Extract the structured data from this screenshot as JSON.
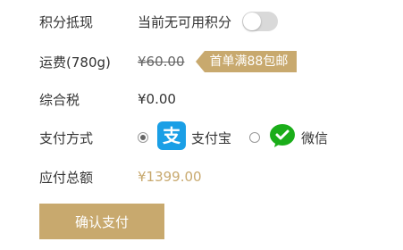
{
  "colors": {
    "accent": "#c8a96e",
    "toggle_off": "#d9d9d9",
    "alipay": "#1a9fe6",
    "wechat": "#1aad19"
  },
  "points": {
    "label": "积分抵现",
    "status": "当前无可用积分",
    "toggle_on": false
  },
  "shipping": {
    "label": "运费(780g)",
    "original_price": "¥60.00",
    "promo": "首单满88包邮"
  },
  "tax": {
    "label": "综合税",
    "value": "¥0.00"
  },
  "payment": {
    "label": "支付方式",
    "options": [
      {
        "name": "支付宝",
        "icon": "alipay-icon",
        "selected": true
      },
      {
        "name": "微信",
        "icon": "wechat-icon",
        "selected": false
      }
    ]
  },
  "total": {
    "label": "应付总额",
    "value": "¥1399.00"
  },
  "confirm_button": {
    "label": "确认支付"
  }
}
